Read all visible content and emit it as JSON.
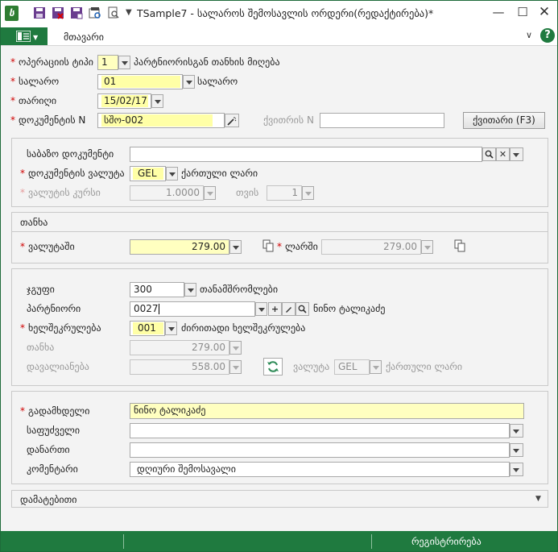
{
  "window": {
    "title": "TSample7 - სალაროს შემოსავლის ორდერი(რედაქტირება)*"
  },
  "menu": {
    "tab_main": "მთავარი",
    "help": "?"
  },
  "form": {
    "op_type": {
      "label": "ოპერაციის ტიპი",
      "value": "1",
      "desc": "პარტნიორისგან თანხის მიღება"
    },
    "cashbox": {
      "label": "სალარო",
      "value": "01",
      "desc": "სალარო"
    },
    "date": {
      "label": "თარიღი",
      "value": "15/02/17"
    },
    "doc_no": {
      "label": "დოკუმენტის N",
      "value": "სშო-002"
    },
    "receipt_no": {
      "label": "ქვითრის N",
      "value": ""
    },
    "receipt_button": "ქვითარი (F3)"
  },
  "panel_base": {
    "base_doc": {
      "label": "საბაზო დოკუმენტი",
      "value": ""
    },
    "doc_currency": {
      "label": "დოკუმენტის ვალუტა",
      "value": "GEL",
      "desc": "ქართული ლარი"
    },
    "rate": {
      "label": "ვალუტის კურსი",
      "value": "1.0000",
      "per_label": "თვის",
      "per_value": "1"
    }
  },
  "panel_amount": {
    "title": "თანხა",
    "in_currency": {
      "label": "ვალუტაში",
      "value": "279.00"
    },
    "in_lari": {
      "label": "ლარში",
      "value": "279.00"
    }
  },
  "panel_partner": {
    "group": {
      "label": "ჯგუფი",
      "value": "300",
      "desc": "თანამშრომლები"
    },
    "partner": {
      "label": "პარტნიორი",
      "value": "0027",
      "desc": "ნინო ტალიკაძე"
    },
    "contract": {
      "label": "ხელშეკრულება",
      "value": "001",
      "desc": "ძირითადი ხელშეკრულება"
    },
    "amount": {
      "label": "თანხა",
      "value": "279.00"
    },
    "debt": {
      "label": "დავალიანება",
      "value": "558.00",
      "currency_label": "ვალუტა",
      "currency_value": "GEL",
      "currency_desc": "ქართული ლარი"
    }
  },
  "panel_payer": {
    "payer": {
      "label": "გადამხდელი",
      "value": "ნინო ტალიკაძე"
    },
    "basis": {
      "label": "საფუძველი",
      "value": ""
    },
    "attachment": {
      "label": "დანართი",
      "value": ""
    },
    "comment": {
      "label": "კომენტარი",
      "value": "დღიური შემოსავალი"
    }
  },
  "panel_extra": {
    "title": "დამატებითი"
  },
  "status": {
    "register_button": "რეგისტრირება"
  }
}
